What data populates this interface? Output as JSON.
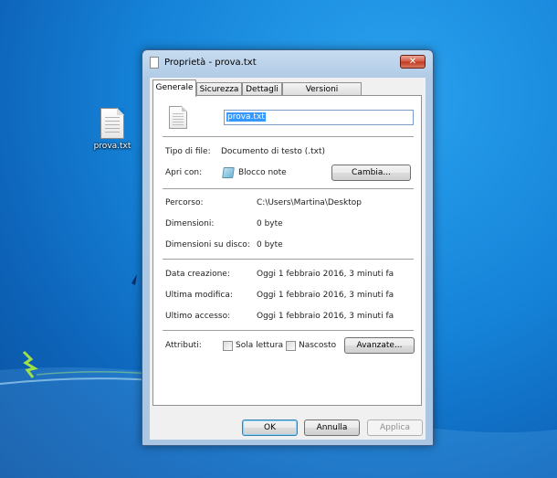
{
  "desktop": {
    "icon_label": "prova.txt"
  },
  "window": {
    "title": "Proprietà - prova.txt",
    "close_glyph": "✕"
  },
  "tabs": [
    {
      "label": "Generale",
      "active": true
    },
    {
      "label": "Sicurezza",
      "active": false
    },
    {
      "label": "Dettagli",
      "active": false
    },
    {
      "label": "Versioni precedenti",
      "active": false
    }
  ],
  "general": {
    "file_name": "prova.txt",
    "file_type_label": "Tipo di file:",
    "file_type_value": "Documento di testo (.txt)",
    "open_with_label": "Apri con:",
    "open_with_value": "Blocco note",
    "change_button": "Cambia...",
    "path_label": "Percorso:",
    "path_value": "C:\\Users\\Martina\\Desktop",
    "size_label": "Dimensioni:",
    "size_value": "0 byte",
    "size_on_disk_label": "Dimensioni su disco:",
    "size_on_disk_value": "0 byte",
    "created_label": "Data creazione:",
    "created_value": "Oggi 1 febbraio 2016, 3 minuti fa",
    "modified_label": "Ultima modifica:",
    "modified_value": "Oggi 1 febbraio 2016, 3 minuti fa",
    "accessed_label": "Ultimo accesso:",
    "accessed_value": "Oggi 1 febbraio 2016, 3 minuti fa",
    "attributes_label": "Attributi:",
    "readonly_label": "Sola lettura",
    "readonly_checked": false,
    "hidden_label": "Nascosto",
    "hidden_checked": false,
    "advanced_button": "Avanzate..."
  },
  "footer": {
    "ok": "OK",
    "cancel": "Annulla",
    "apply": "Applica"
  }
}
